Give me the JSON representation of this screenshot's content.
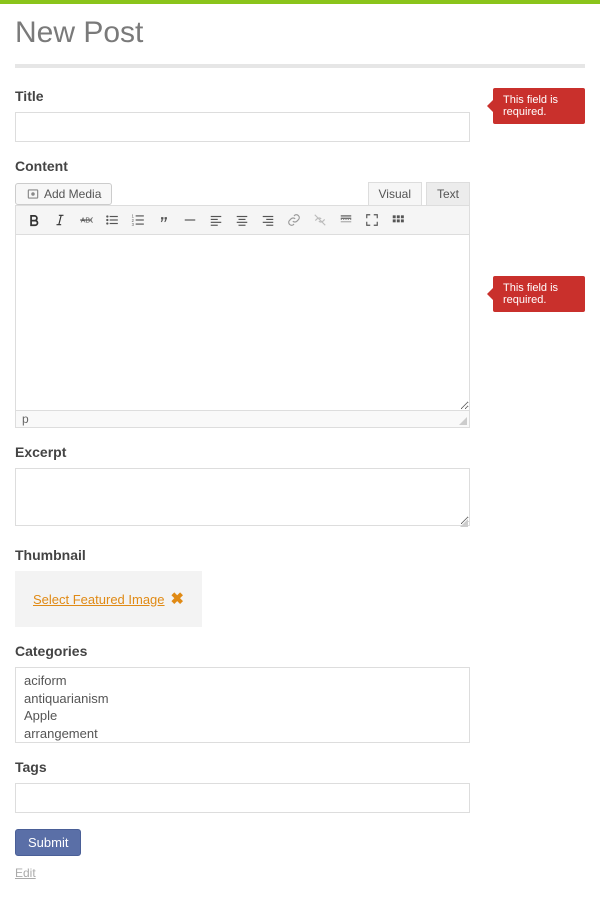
{
  "page_title": "New Post",
  "labels": {
    "title": "Title",
    "content": "Content",
    "excerpt": "Excerpt",
    "thumbnail": "Thumbnail",
    "categories": "Categories",
    "tags": "Tags"
  },
  "errors": {
    "title": "This field is required.",
    "content": "This field is required."
  },
  "editor": {
    "add_media": "Add Media",
    "tabs": {
      "visual": "Visual",
      "text": "Text",
      "active": "visual"
    },
    "buttons": [
      "bold",
      "italic",
      "strikethrough",
      "bullet-list",
      "numbered-list",
      "blockquote",
      "hr",
      "align-left",
      "align-center",
      "align-right",
      "link",
      "unlink",
      "insert-more",
      "fullscreen",
      "toolbar-toggle"
    ],
    "status": "p",
    "body_value": ""
  },
  "title_value": "",
  "excerpt_value": "",
  "thumbnail": {
    "link_text": "Select Featured Image",
    "clear": "✖"
  },
  "categories": [
    "aciform",
    "antiquarianism",
    "Apple",
    "arrangement"
  ],
  "tags_value": "",
  "submit_label": "Submit",
  "edit_link": "Edit"
}
